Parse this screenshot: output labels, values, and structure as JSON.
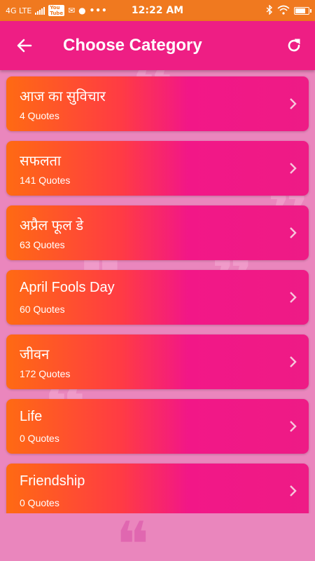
{
  "status_bar": {
    "network": "4G LTE",
    "yt_label": "YouTube",
    "time": "12:22 AM",
    "dots": "•••"
  },
  "header": {
    "title": "Choose Category",
    "back_icon": "arrow-back-icon",
    "refresh_icon": "refresh-icon"
  },
  "categories": [
    {
      "title": "आज का सुविचार",
      "count": "4 Quotes"
    },
    {
      "title": "सफलता",
      "count": "141 Quotes"
    },
    {
      "title": "अप्रैल फूल डे",
      "count": "63 Quotes"
    },
    {
      "title": "April Fools Day",
      "count": "60 Quotes"
    },
    {
      "title": "जीवन",
      "count": "172 Quotes"
    },
    {
      "title": "Life",
      "count": "0 Quotes"
    },
    {
      "title": "Friendship",
      "count": "0 Quotes"
    }
  ],
  "colors": {
    "status_bar": "#f0791f",
    "app_bar": "#ee1e84",
    "background": "#ea86bd",
    "card_gradient_start": "#ff6a13",
    "card_gradient_end": "#ee1b86"
  }
}
